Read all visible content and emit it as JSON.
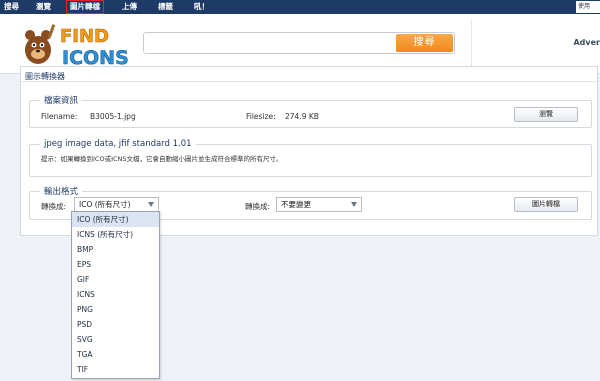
{
  "nav": {
    "items": [
      "搜尋",
      "瀏覽",
      "圖片轉檔",
      "上傳",
      "標籤",
      "吼！"
    ],
    "active_index": 2,
    "right_text": "使用"
  },
  "logo": {
    "line1": "FIND",
    "line2": "ICONS"
  },
  "search": {
    "placeholder": "",
    "button_label": "搜尋"
  },
  "ad": {
    "text": "Adver"
  },
  "panel": {
    "title": "圖示轉換器"
  },
  "file_info": {
    "legend": "檔案資訊",
    "filename_label": "Filename:",
    "filename_value": "B3005-1.jpg",
    "filesize_label": "Filesize:",
    "filesize_value": "274.9 KB",
    "browse_button": "瀏覽"
  },
  "jpeg_info": {
    "legend": "jpeg image data, jfif standard 1.01",
    "hint": "提示：如果轉換到ICO或ICNS文檔，它會自動縮小圖片並生成符合標準的所有尺寸。"
  },
  "output": {
    "legend": "輸出格式",
    "convert_label_1": "轉換成:",
    "format_selected": "ICO (所有尺寸)",
    "convert_label_2": "轉換成:",
    "size_selected": "不要變更",
    "convert_button": "圖片轉檔"
  },
  "dropdown": {
    "options": [
      "ICO (所有尺寸)",
      "ICNS (所有尺寸)",
      "BMP",
      "EPS",
      "GIF",
      "ICNS",
      "PNG",
      "PSD",
      "SVG",
      "TGA",
      "TIF"
    ],
    "selected_index": 0
  },
  "colors": {
    "nav_bg": "#1e3b68",
    "active_border": "#e0242a",
    "search_button": "#f08a1c",
    "highlight": "#dbe4f0"
  }
}
